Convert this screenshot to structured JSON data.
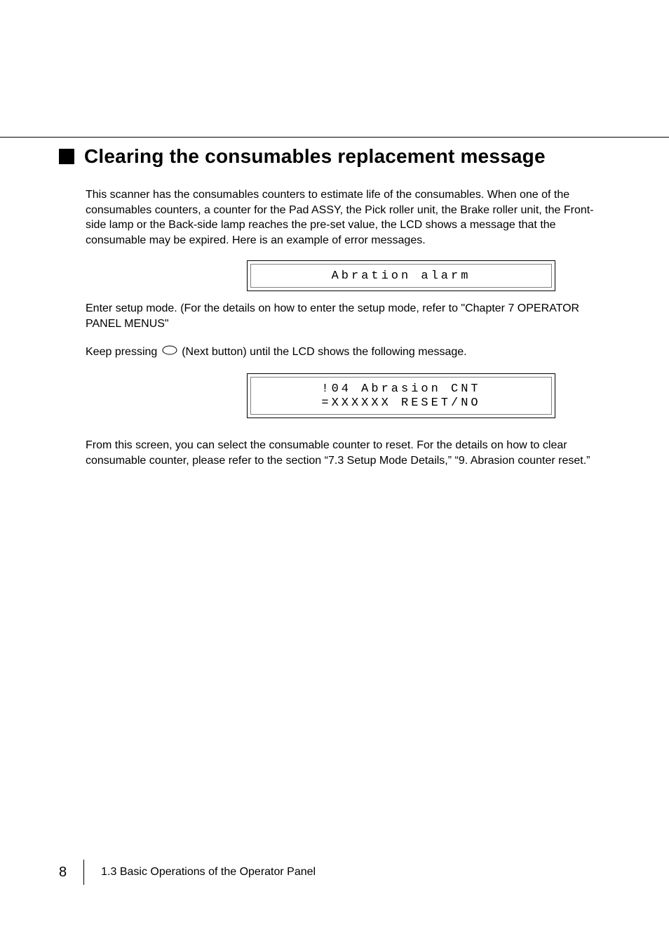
{
  "heading": "Clearing the consumables replacement message",
  "p1": "This scanner has the consumables counters to estimate life of the consumables. When one of the consumables counters, a counter for the Pad ASSY, the Pick roller unit, the Brake roller unit, the Front-side lamp or the Back-side lamp reaches the pre-set value, the LCD shows a message that the consumable may be expired. Here is an example of error messages.",
  "lcd1_line1": "Abration alarm",
  "p2": "Enter setup mode. (For the details on how to enter the setup mode, refer to \"Chapter 7 OPERATOR PANEL MENUS\"",
  "p3_a": "Keep pressing",
  "p3_b": "(Next button) until the LCD shows the following message.",
  "lcd2_line1": "!04 Abrasion CNT",
  "lcd2_line2": "=XXXXXX RESET/NO",
  "p4": "From this screen, you can select the consumable counter to reset. For the details on how to clear consumable counter, please refer to the section “7.3 Setup Mode Details,” “9. Abrasion counter reset.”",
  "page_number": "8",
  "footer_text": "1.3  Basic Operations of the Operator Panel"
}
